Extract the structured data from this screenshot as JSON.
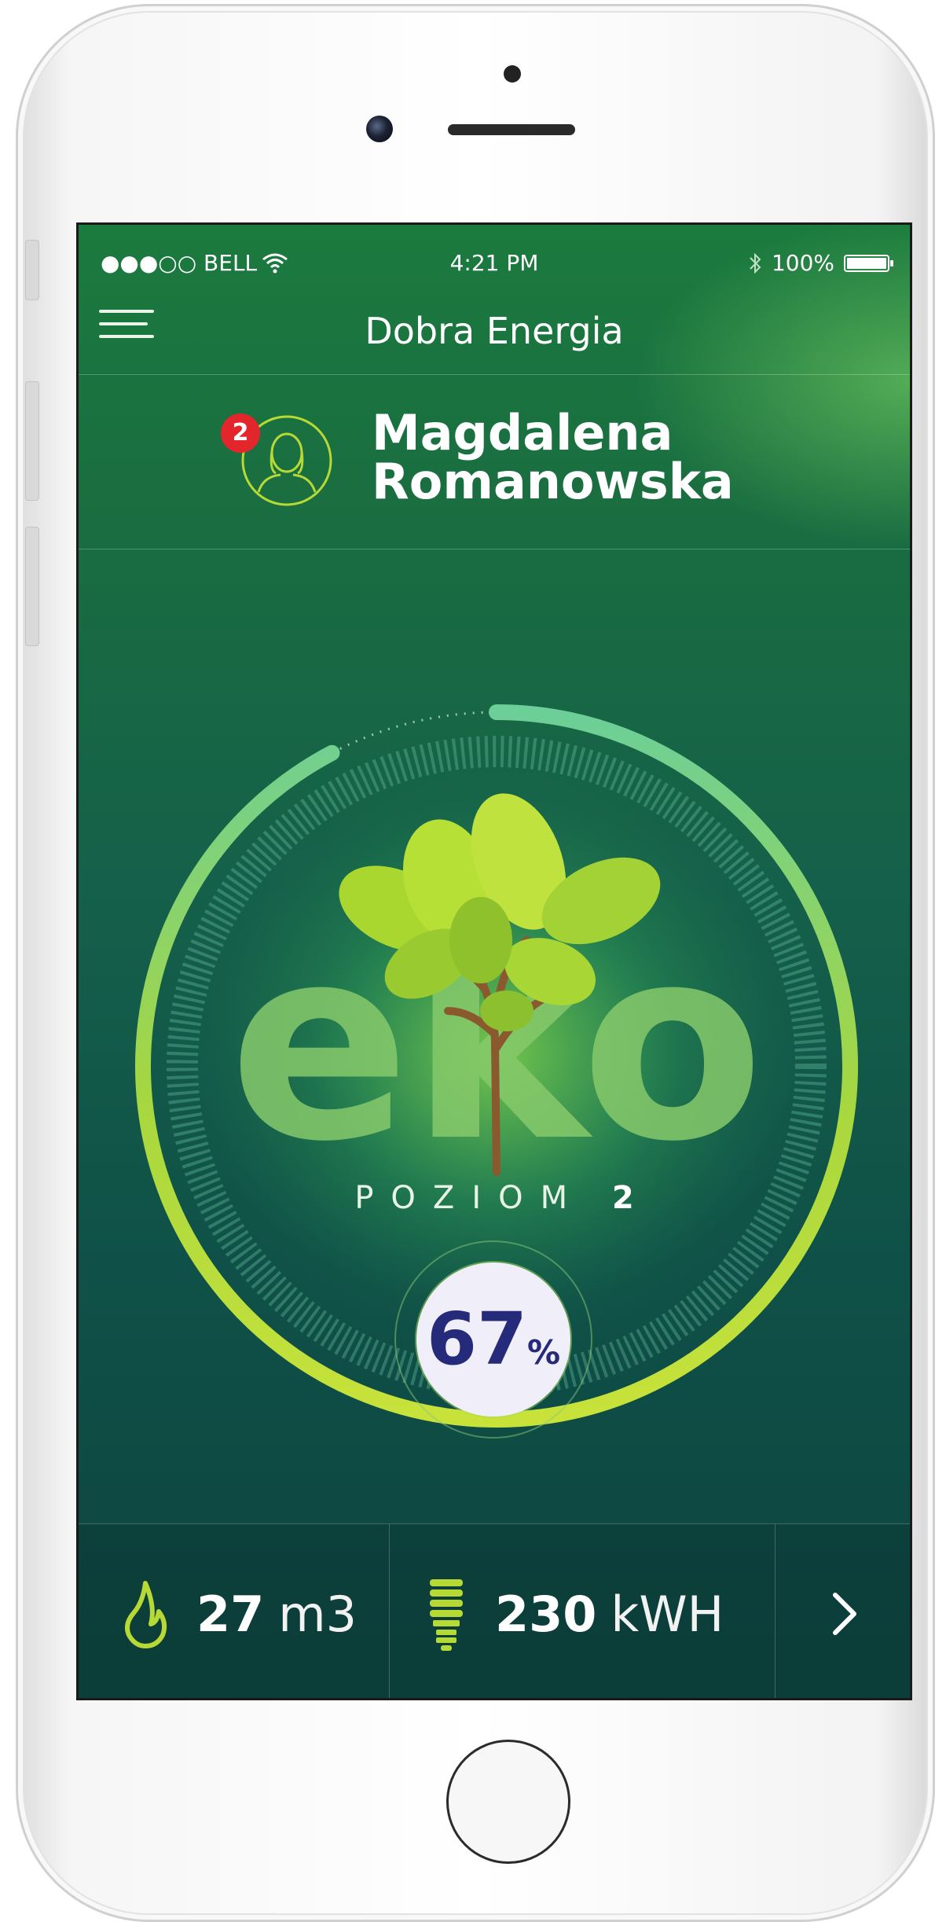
{
  "status_bar": {
    "carrier": "●●●○○ BELL",
    "time": "4:21 PM",
    "battery": "100%",
    "battery_level": 1.0
  },
  "header": {
    "title": "Dobra Energia"
  },
  "profile": {
    "notification_count": "2",
    "first_name": "Magdalena",
    "last_name": "Romanowska"
  },
  "eco": {
    "logo_text": "eko",
    "level_label": "POZIOM",
    "level_value": "2",
    "progress_value": "67",
    "progress_unit": "%",
    "progress_fraction": 0.67
  },
  "usage": {
    "gas_value": "27",
    "gas_unit": "m3",
    "electricity_value": "230",
    "electricity_unit": "kWH"
  },
  "colors": {
    "accent_lime": "#b6d936",
    "badge_red": "#e3262b",
    "percent_text": "#262a7a"
  }
}
